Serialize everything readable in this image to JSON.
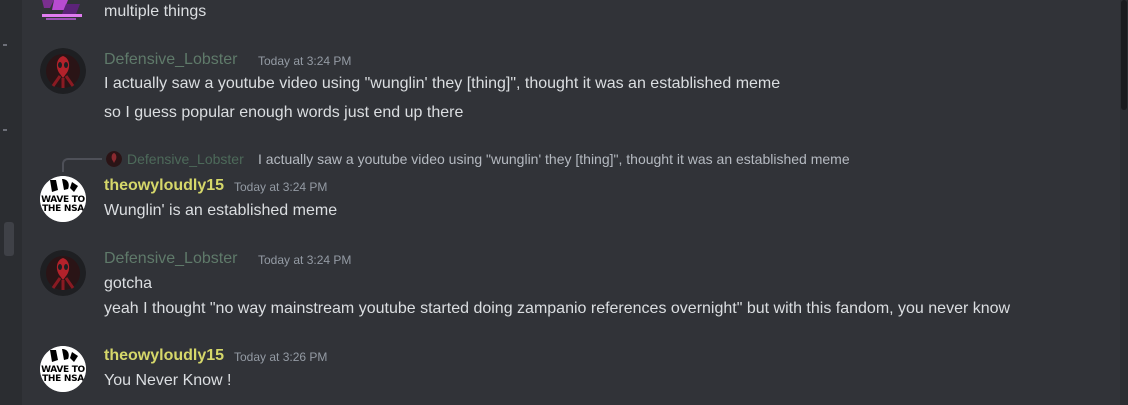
{
  "colors": {
    "background": "#313338",
    "lobster_name": "#5f7a6a",
    "theowy_name": "#d6d86a",
    "message_text": "#dbdee1",
    "timestamp": "#949ba4"
  },
  "top_partial": {
    "text": "multiple things",
    "avatar_icon": "purple-logo-avatar-icon"
  },
  "messages": [
    {
      "username": "Defensive_Lobster",
      "timestamp": "Today at 3:24 PM",
      "avatar_icon": "red-lobster-avatar-icon",
      "lines": [
        "I actually saw a youtube video using \"wunglin' they [thing]\", thought it was an established meme",
        "so I guess popular enough words just end up there"
      ]
    },
    {
      "reply_to": {
        "username": "Defensive_Lobster",
        "text": "I actually saw a youtube video using \"wunglin' they [thing]\", thought it was an established meme"
      },
      "username": "theowyloudly15",
      "timestamp": "Today at 3:24 PM",
      "avatar_icon": "wave-to-the-nsa-avatar-icon",
      "avatar_text": [
        "WAVE TO",
        "THE NSA"
      ],
      "lines": [
        "Wunglin' is an established meme"
      ]
    },
    {
      "username": "Defensive_Lobster",
      "timestamp": "Today at 3:24 PM",
      "avatar_icon": "red-lobster-avatar-icon",
      "lines": [
        "gotcha",
        "yeah I thought \"no way mainstream youtube started doing zampanio references overnight\" but with this fandom, you never know"
      ]
    },
    {
      "username": "theowyloudly15",
      "timestamp": "Today at 3:26 PM",
      "avatar_icon": "wave-to-the-nsa-avatar-icon",
      "avatar_text": [
        "WAVE TO",
        "THE NSA"
      ],
      "lines": [
        "You Never Know !"
      ]
    }
  ]
}
